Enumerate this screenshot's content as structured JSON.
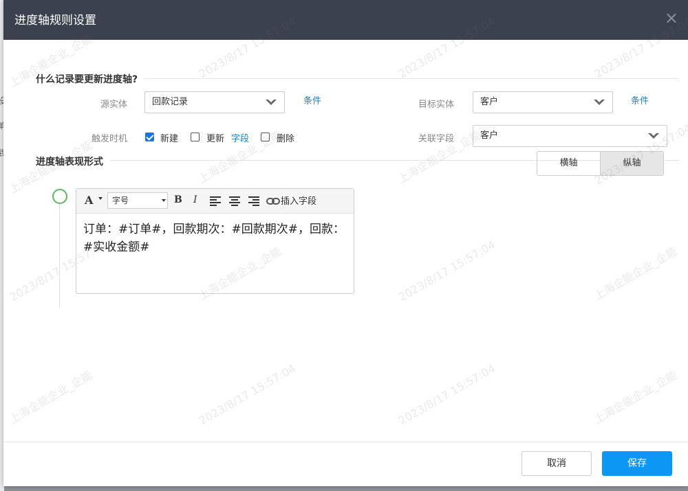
{
  "dialog": {
    "title": "进度轴规则设置",
    "close_icon": "×"
  },
  "background_page": {
    "fragments": [
      "设",
      "单",
      "武"
    ]
  },
  "section1": {
    "title": "什么记录要更新进度轴?",
    "source_entity": {
      "label": "源实体",
      "value": "回款记录",
      "condition_link": "条件"
    },
    "target_entity": {
      "label": "目标实体",
      "value": "客户",
      "condition_link": "条件"
    },
    "trigger": {
      "label": "触发时机",
      "options": [
        {
          "label": "新建",
          "checked": true
        },
        {
          "label": "更新",
          "checked": false
        },
        {
          "label": "删除",
          "checked": false
        }
      ],
      "field_link": "字段"
    },
    "related_field": {
      "label": "关联字段",
      "value": "客户"
    }
  },
  "section2": {
    "title": "进度轴表现形式",
    "orientation": {
      "options": [
        "横轴",
        "纵轴"
      ],
      "selected": "纵轴"
    }
  },
  "editor": {
    "toolbar": {
      "font_color": "A",
      "font_size": "字号",
      "bold": "B",
      "italic": "I",
      "insert_field": "插入字段"
    },
    "content": "订单：#订单#，回款期次：#回款期次#，回款：#实收金额#"
  },
  "footer": {
    "cancel": "取消",
    "save": "保存"
  },
  "watermark": {
    "timestamp": "2023/8/17 15:57:04",
    "company": "上海企能企业_企能"
  },
  "colors": {
    "titlebar": "#3b414e",
    "primary": "#0d97f5",
    "link": "#1a7fd1",
    "timeline": "#5cb85c"
  }
}
